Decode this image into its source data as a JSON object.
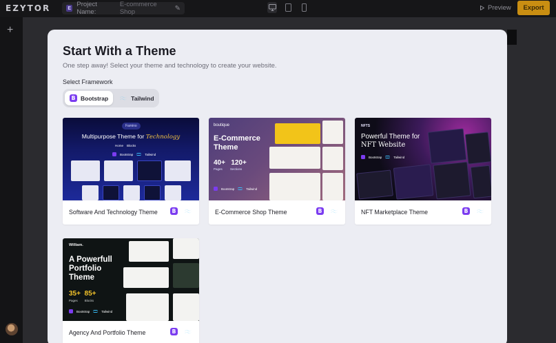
{
  "app": {
    "logo": "EZYTOR",
    "project_label": "Project Name:",
    "project_value": "E-commerce Shop",
    "preview_label": "Preview",
    "export_label": "Export",
    "devices": [
      "desktop-icon",
      "tablet-icon",
      "mobile-icon"
    ]
  },
  "modal": {
    "title": "Start With a Theme",
    "subtitle": "One step away! Select your theme and technology to create your website.",
    "framework_label": "Select Framework",
    "frameworks": [
      {
        "label": "Bootstrap",
        "selected": true
      },
      {
        "label": "Tailwind",
        "selected": false
      }
    ],
    "themes": [
      {
        "caption": "Software And Technology Theme",
        "preview": {
          "pill": "Famino",
          "headline": "Multipurpose Theme for",
          "headline_accent": "Technology",
          "tags": [
            "Home",
            "Blocks"
          ],
          "tech": [
            "Bootstrap",
            "Tailwind"
          ]
        }
      },
      {
        "caption": "E-Commerce Shop Theme",
        "preview": {
          "brand": "boutique",
          "headline_1": "E-Commerce",
          "headline_2": "Theme",
          "stat_1": "40+",
          "stat_1_label": "Pages",
          "stat_2": "120+",
          "stat_2_label": "Sections",
          "tech": [
            "Bootstrap",
            "Tailwind"
          ]
        }
      },
      {
        "caption": "NFT Marketplace Theme",
        "preview": {
          "brand": "NFTS",
          "headline_1": "Powerful Theme for",
          "headline_2": "NFT Website",
          "tech": [
            "Bootstrap",
            "Tailwind"
          ]
        }
      },
      {
        "caption": "Agency And Portfolio Theme",
        "preview": {
          "brand": "William.",
          "headline_1": "A Powerfull",
          "headline_2": "Portfolio",
          "headline_3": "Theme",
          "stat_1": "35+",
          "stat_1_label": "Pages",
          "stat_2": "85+",
          "stat_2_label": "Blocks",
          "tech": [
            "Bootstrap",
            "Tailwind"
          ]
        }
      }
    ]
  },
  "colors": {
    "accent": "#c98e12",
    "bootstrap": "#7b3cf0",
    "tailwind": "#38bdf8",
    "modal_bg": "#ecedf3"
  }
}
